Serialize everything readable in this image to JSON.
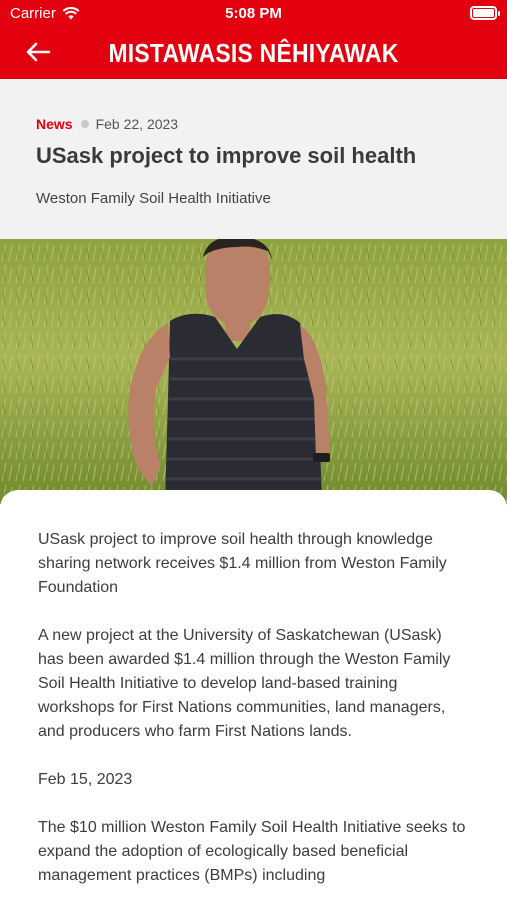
{
  "status_bar": {
    "carrier": "Carrier",
    "time": "5:08 PM"
  },
  "nav": {
    "title": "MISTAWASIS NÊHIYAWAK"
  },
  "article": {
    "category": "News",
    "date": "Feb 22, 2023",
    "title": "USask project to improve soil health",
    "subtitle": "Weston Family Soil Health Initiative",
    "paragraphs": [
      "USask project to improve soil health through knowledge sharing network receives $1.4 million from Weston Family Foundation",
      "A new project at the University of Saskatchewan (USask) has been awarded $1.4 million through the Weston Family Soil Health Initiative to develop land-based training workshops for First Nations communities, land managers, and producers who farm First Nations lands.",
      "Feb 15, 2023",
      "The $10 million Weston Family Soil Health Initiative seeks to expand the adoption of ecologically based beneficial management practices (BMPs) including"
    ]
  },
  "colors": {
    "brand_red": "#e3000f"
  }
}
